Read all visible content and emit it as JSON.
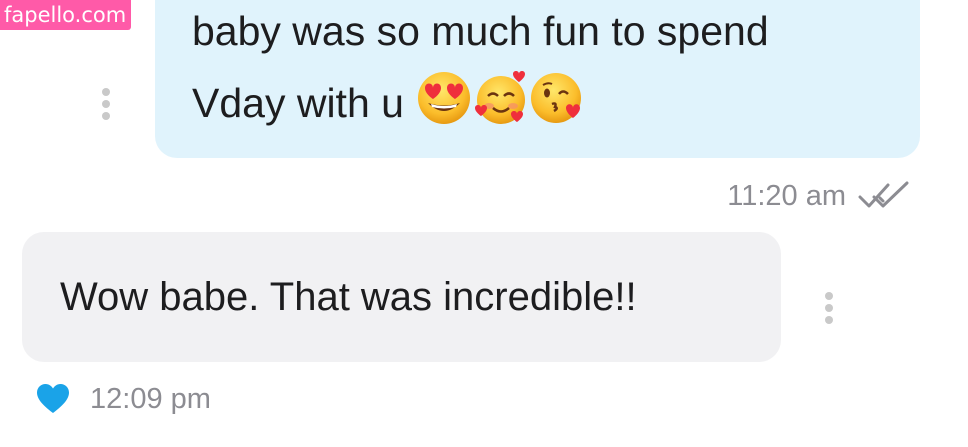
{
  "watermark": {
    "text": "fapello.com"
  },
  "messages": [
    {
      "direction": "outgoing",
      "text": "baby was so much fun to spend\nVday with u",
      "emojis": [
        "heart-eyes-face",
        "smiling-face-with-hearts",
        "face-blowing-kiss"
      ],
      "time": "11:20 am",
      "status_icon": "double-check-read-icon"
    },
    {
      "direction": "incoming",
      "text": "Wow babe. That was incredible!!",
      "time": "12:09 pm",
      "reaction_icon": "heart-icon"
    }
  ],
  "colors": {
    "outgoing_bubble": "#e0f3fc",
    "incoming_bubble": "#f1f1f3",
    "heart": "#1aa3e8",
    "timestamp": "#8c8c92",
    "watermark_bg": "#ff5aa8"
  }
}
